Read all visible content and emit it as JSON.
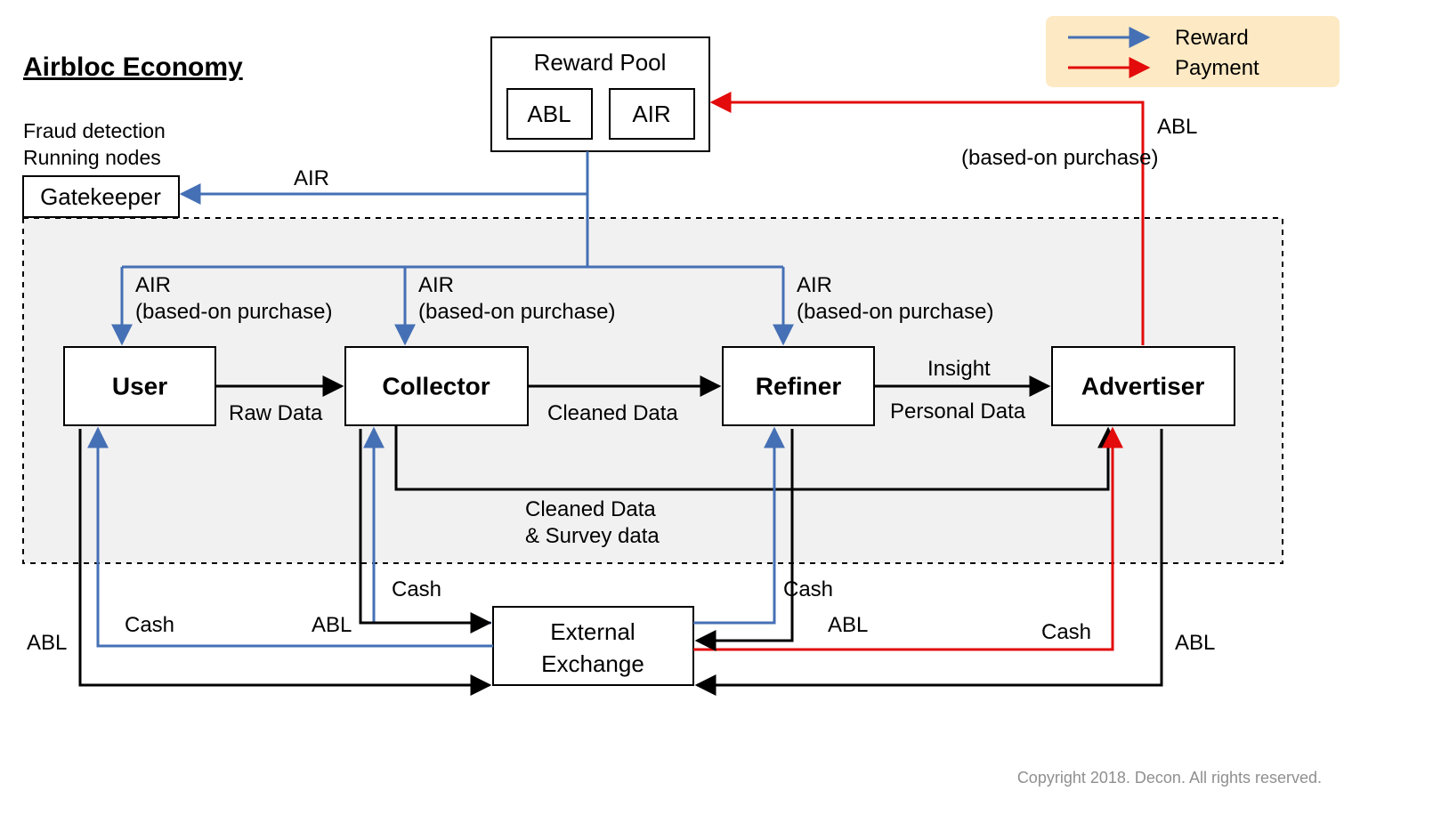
{
  "title": "Airbloc Economy",
  "gatekeeper_note1": "Fraud detection",
  "gatekeeper_note2": "Running nodes",
  "nodes": {
    "reward_pool": "Reward Pool",
    "abl": "ABL",
    "air": "AIR",
    "gatekeeper": "Gatekeeper",
    "user": "User",
    "collector": "Collector",
    "refiner": "Refiner",
    "advertiser": "Advertiser",
    "exchange1": "External",
    "exchange2": "Exchange"
  },
  "edges": {
    "air": "AIR",
    "air_based": "(based-on purchase)",
    "abl": "ABL",
    "abl_based": "(based-on purchase)",
    "raw_data": "Raw Data",
    "cleaned_data": "Cleaned Data",
    "insight": "Insight",
    "personal_data": "Personal Data",
    "cleaned_survey1": "Cleaned Data",
    "cleaned_survey2": "& Survey data",
    "cash": "Cash"
  },
  "legend": {
    "reward": "Reward",
    "payment": "Payment"
  },
  "copyright1": "Copyright 2018. Decon",
  "copyright2": ". All rights reserved."
}
